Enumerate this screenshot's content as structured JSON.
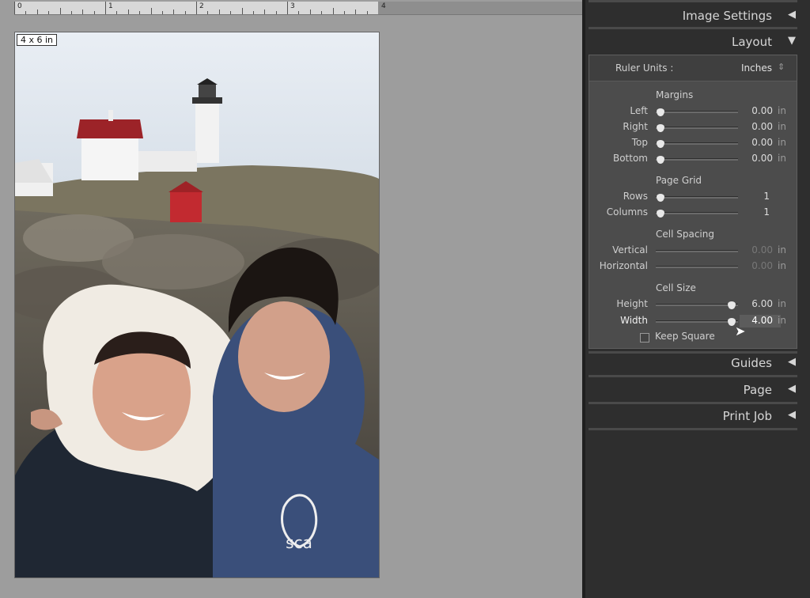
{
  "ruler": {
    "numbers": [
      "0",
      "1",
      "2",
      "3",
      "4"
    ]
  },
  "page": {
    "size_label": "4 x 6 in",
    "photo_logo_text": "sca"
  },
  "panel": {
    "sections": {
      "image_settings": "Image Settings",
      "layout": "Layout",
      "guides": "Guides",
      "page": "Page",
      "print_job": "Print Job"
    },
    "arrows": {
      "collapsed": "◀",
      "expanded": "▼"
    },
    "ruler_units": {
      "label": "Ruler Units :",
      "value": "Inches",
      "stepper": "⇕"
    },
    "margins": {
      "title": "Margins",
      "rows": [
        {
          "label": "Left",
          "value": "0.00",
          "unit": "in"
        },
        {
          "label": "Right",
          "value": "0.00",
          "unit": "in"
        },
        {
          "label": "Top",
          "value": "0.00",
          "unit": "in"
        },
        {
          "label": "Bottom",
          "value": "0.00",
          "unit": "in"
        }
      ]
    },
    "page_grid": {
      "title": "Page Grid",
      "rows": [
        {
          "label": "Rows",
          "value": "1"
        },
        {
          "label": "Columns",
          "value": "1"
        }
      ]
    },
    "cell_spacing": {
      "title": "Cell Spacing",
      "rows": [
        {
          "label": "Vertical",
          "value": "0.00",
          "unit": "in"
        },
        {
          "label": "Horizontal",
          "value": "0.00",
          "unit": "in"
        }
      ]
    },
    "cell_size": {
      "title": "Cell Size",
      "rows": [
        {
          "label": "Height",
          "value": "6.00",
          "unit": "in"
        },
        {
          "label": "Width",
          "value": "4.00",
          "unit": "in"
        }
      ]
    },
    "keep_square": {
      "label": "Keep Square",
      "checked": false
    }
  },
  "colors": {
    "panel_bg": "#2e2e2e",
    "layout_bg": "#4c4c4c",
    "canvas_bg": "#9d9d9d"
  }
}
